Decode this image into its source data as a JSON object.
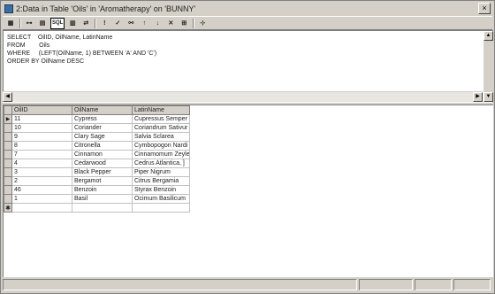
{
  "window": {
    "title": "2:Data in Table 'Oils' in 'Aromatherapy' on 'BUNNY'",
    "close_glyph": "×"
  },
  "toolbar": {
    "buttons": [
      {
        "name": "properties-icon",
        "glyph": "▦"
      },
      {
        "name": "show-diagram-pane-button",
        "glyph": "⊶"
      },
      {
        "name": "show-grid-pane-button",
        "glyph": "▤"
      },
      {
        "name": "show-sql-pane-button",
        "label": "SQL"
      },
      {
        "name": "show-results-pane-button",
        "glyph": "▥"
      },
      {
        "name": "change-query-type-button",
        "glyph": "⇄"
      },
      {
        "name": "run-button",
        "glyph": "!"
      },
      {
        "name": "verify-sql-button",
        "glyph": "✓"
      },
      {
        "name": "remove-filter-button",
        "glyph": "⚯"
      },
      {
        "name": "sort-ascending-button",
        "glyph": "↑"
      },
      {
        "name": "sort-descending-button",
        "glyph": "↓"
      },
      {
        "name": "remove-filter-x-button",
        "glyph": "✕"
      },
      {
        "name": "group-by-button",
        "glyph": "⊞"
      },
      {
        "name": "add-table-button",
        "glyph": "⊹"
      }
    ]
  },
  "sql": {
    "text": "SELECT    OilID, OilName, LatinName\nFROM        Oils\nWHERE     (LEFT(OilName, 1) BETWEEN 'A' AND 'C')\nORDER BY OilName DESC"
  },
  "grid": {
    "columns": [
      "OilID",
      "OilName",
      "LatinName"
    ],
    "rows": [
      [
        "11",
        "Cypress",
        "Cupressus Semper"
      ],
      [
        "10",
        "Coriander",
        "Coriandrum Sativur"
      ],
      [
        "9",
        "Clary Sage",
        "Salvia Sclarea"
      ],
      [
        "8",
        "Citronella",
        "Cymbopogon Nardi"
      ],
      [
        "7",
        "Cinnamon",
        "Cinnamomum Zeyle"
      ],
      [
        "4",
        "Cedarwood",
        "Cedrus Atlantica, ]"
      ],
      [
        "3",
        "Black Pepper",
        "Piper Nigrum"
      ],
      [
        "2",
        "Bergamot",
        "Citrus Bergamia"
      ],
      [
        "46",
        "Benzoin",
        "Styrax Benzoin"
      ],
      [
        "1",
        "Basil",
        "Ocimum Basilicum"
      ]
    ],
    "current_row_indicator": "▶",
    "new_row_indicator": "✱"
  },
  "scroll": {
    "up": "▲",
    "down": "▼",
    "left": "◀",
    "right": "▶"
  }
}
